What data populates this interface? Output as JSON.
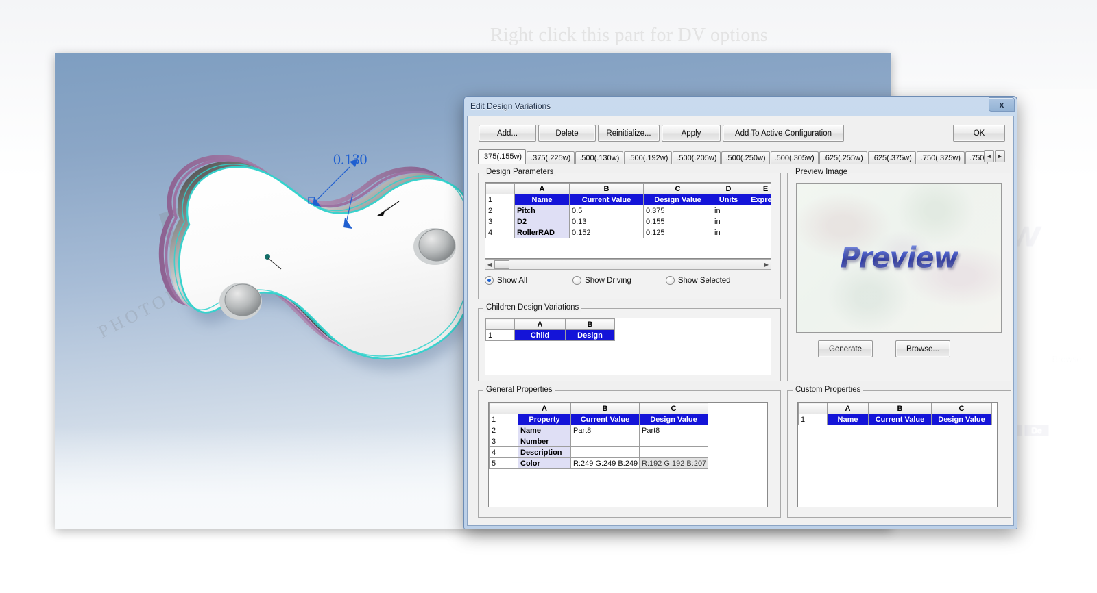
{
  "viewport": {
    "hint_text": "Right click this part for DV options",
    "hint_text_ghost": "Right click this part for DV options",
    "dimension_label": "0.130",
    "watermark_site": "PHOTOPHOTO.CN"
  },
  "dialog": {
    "title": "Edit Design Variations",
    "close_label": "x",
    "toolbar": {
      "add": "Add...",
      "delete": "Delete",
      "reinitialize": "Reinitialize...",
      "apply": "Apply",
      "add_to_active_configuration": "Add To Active Configuration",
      "ok": "OK"
    },
    "tabs": {
      "items": [
        {
          "label": ".375(.155w)",
          "active": true
        },
        {
          "label": ".375(.225w)",
          "active": false
        },
        {
          "label": ".500(.130w)",
          "active": false
        },
        {
          "label": ".500(.192w)",
          "active": false
        },
        {
          "label": ".500(.205w)",
          "active": false
        },
        {
          "label": ".500(.250w)",
          "active": false
        },
        {
          "label": ".500(.305w)",
          "active": false
        },
        {
          "label": ".625(.255w)",
          "active": false
        },
        {
          "label": ".625(.375w)",
          "active": false
        },
        {
          "label": ".750(.375w)",
          "active": false
        },
        {
          "label": ".750",
          "active": false
        }
      ],
      "nav_prev": "◄",
      "nav_next": "►"
    },
    "design_parameters": {
      "group_label": "Design Parameters",
      "column_letters": [
        "",
        "A",
        "B",
        "C",
        "D",
        "E"
      ],
      "header_row": {
        "num": "1",
        "cells": [
          "Name",
          "Current Value",
          "Design Value",
          "Units",
          "Express"
        ]
      },
      "rows": [
        {
          "num": "2",
          "name": "Pitch",
          "current": "0.5",
          "design": "0.375",
          "units": "in",
          "expression": ""
        },
        {
          "num": "3",
          "name": "D2",
          "current": "0.13",
          "design": "0.155",
          "units": "in",
          "expression": ""
        },
        {
          "num": "4",
          "name": "RollerRAD",
          "current": "0.152",
          "design": "0.125",
          "units": "in",
          "expression": ""
        }
      ],
      "radios": [
        {
          "label": "Show All",
          "selected": true
        },
        {
          "label": "Show Driving",
          "selected": false
        },
        {
          "label": "Show Selected",
          "selected": false
        }
      ]
    },
    "children_design_variations": {
      "group_label": "Children Design Variations",
      "column_letters": [
        "",
        "A",
        "B"
      ],
      "header_row": {
        "num": "1",
        "cells": [
          "Child",
          "Design"
        ]
      }
    },
    "general_properties": {
      "group_label": "General Properties",
      "column_letters": [
        "",
        "A",
        "B",
        "C"
      ],
      "header_row": {
        "num": "1",
        "cells": [
          "Property",
          "Current Value",
          "Design Value"
        ]
      },
      "rows": [
        {
          "num": "2",
          "property": "Name",
          "current": "Part8",
          "design": "Part8"
        },
        {
          "num": "3",
          "property": "Number",
          "current": "",
          "design": ""
        },
        {
          "num": "4",
          "property": "Description",
          "current": "",
          "design": ""
        },
        {
          "num": "5",
          "property": "Color",
          "current": "R:249 G:249 B:249",
          "design": "R:192 G:192 B:207"
        }
      ]
    },
    "preview_image": {
      "group_label": "Preview Image",
      "placeholder_word": "Preview",
      "generate": "Generate",
      "browse": "Browse..."
    },
    "custom_properties": {
      "group_label": "Custom Properties",
      "column_letters": [
        "",
        "A",
        "B",
        "C"
      ],
      "header_row": {
        "num": "1",
        "cells": [
          "Name",
          "Current Value",
          "Design Value"
        ]
      }
    }
  }
}
